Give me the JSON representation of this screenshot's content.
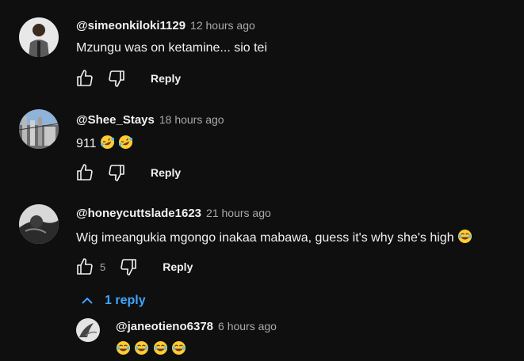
{
  "comments": [
    {
      "author": "@simeonkiloki1129",
      "time": "12 hours ago",
      "text": "Mzungu was on ketamine... sio tei",
      "reply_label": "Reply"
    },
    {
      "author": "@Shee_Stays",
      "time": "18 hours ago",
      "text": "911",
      "reply_label": "Reply"
    },
    {
      "author": "@honeycuttslade1623",
      "time": "21 hours ago",
      "text": "Wig imeangukia mgongo inakaa mabawa, guess it's why she's high",
      "like_count": "5",
      "reply_label": "Reply"
    }
  ],
  "replies_toggle": {
    "label": "1 reply"
  },
  "reply": {
    "author": "@janeotieno6378",
    "time": "6 hours ago"
  },
  "colors": {
    "background": "#0f0f0f",
    "link": "#3ea6ff",
    "muted": "#aaaaaa"
  }
}
